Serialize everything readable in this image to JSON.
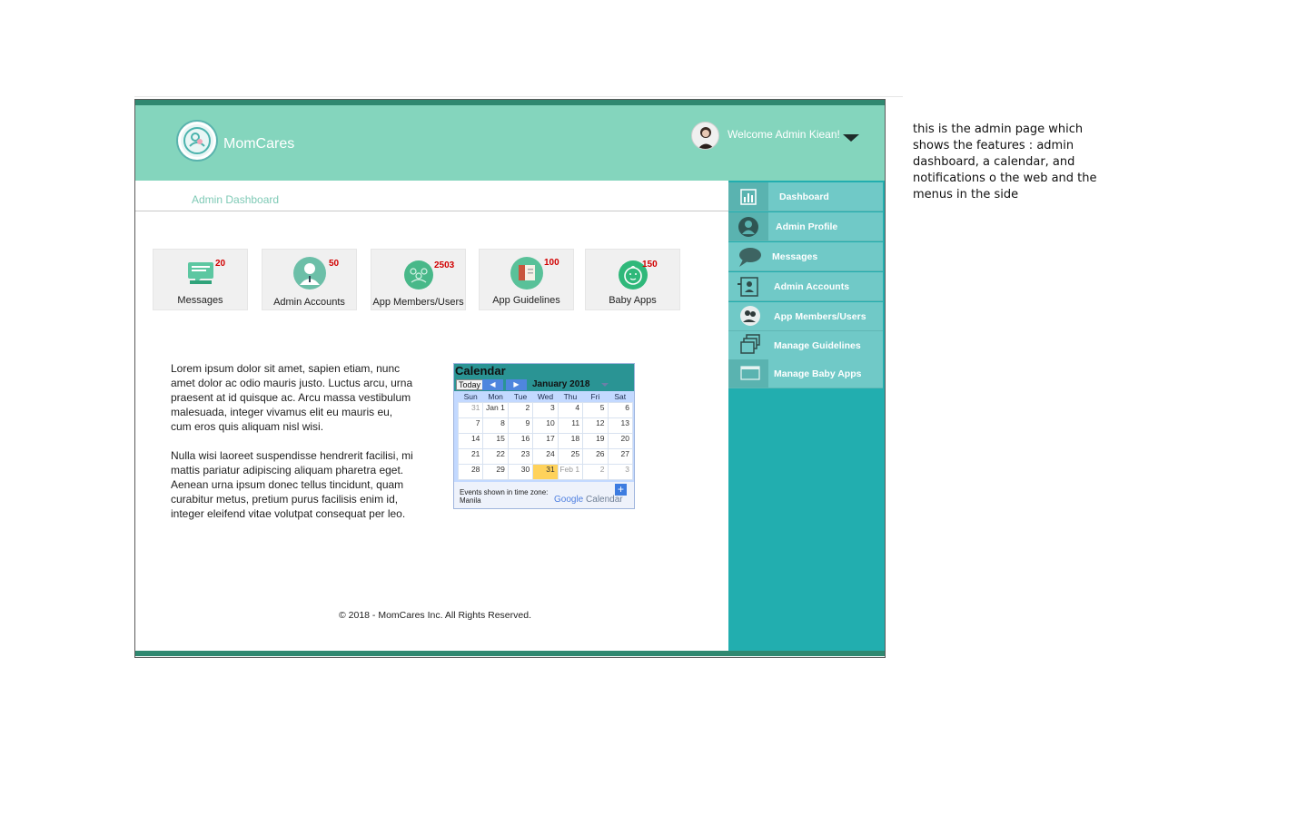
{
  "header": {
    "brand": "MomCares",
    "welcome": "Welcome Admin Kiean!"
  },
  "breadcrumb": "Admin Dashboard",
  "stats": [
    {
      "label": "Messages",
      "count": "20"
    },
    {
      "label": "Admin Accounts",
      "count": "50"
    },
    {
      "label": "App Members/Users",
      "count": "2503"
    },
    {
      "label": "App Guidelines",
      "count": "100"
    },
    {
      "label": "Baby Apps",
      "count": "150"
    }
  ],
  "content": {
    "paragraph1": "Lorem ipsum dolor sit amet, sapien etiam, nunc amet dolor ac odio mauris justo. Luctus arcu, urna praesent at id quisque ac. Arcu massa vestibulum malesuada, integer vivamus elit eu mauris eu, cum eros quis aliquam nisl wisi.",
    "paragraph2": "Nulla wisi laoreet suspendisse hendrerit facilisi, mi mattis pariatur adipiscing aliquam pharetra eget. Aenean urna ipsum donec tellus tincidunt, quam curabitur metus, pretium purus facilisis enim id, integer eleifend vitae volutpat consequat per leo."
  },
  "calendar": {
    "title": "Calendar",
    "today_label": "Today",
    "prev": "◀",
    "next": "▶",
    "month": "January 2018",
    "weekdays": [
      "Sun",
      "Mon",
      "Tue",
      "Wed",
      "Thu",
      "Fri",
      "Sat"
    ],
    "weeks": [
      [
        "31",
        "Jan 1",
        "2",
        "3",
        "4",
        "5",
        "6"
      ],
      [
        "7",
        "8",
        "9",
        "10",
        "11",
        "12",
        "13"
      ],
      [
        "14",
        "15",
        "16",
        "17",
        "18",
        "19",
        "20"
      ],
      [
        "21",
        "22",
        "23",
        "24",
        "25",
        "26",
        "27"
      ],
      [
        "28",
        "29",
        "30",
        "31",
        "Feb 1",
        "2",
        "3"
      ]
    ],
    "today": "31",
    "timezone_note": "Events shown in time zone: Manila",
    "add": "+",
    "brand_google": "Google",
    "brand_calendar": "Calendar"
  },
  "footer": "© 2018 - MomCares Inc. All Rights Reserved.",
  "sidebar": {
    "items": [
      {
        "label": "Dashboard",
        "icon": "chart-icon"
      },
      {
        "label": "Admin Profile",
        "icon": "user-icon"
      },
      {
        "label": "Messages",
        "icon": "chat-icon"
      },
      {
        "label": "Admin Accounts",
        "icon": "badge-icon"
      },
      {
        "label": "App Members/Users",
        "icon": "users-icon"
      },
      {
        "label": "Manage Guidelines",
        "icon": "stack-icon"
      },
      {
        "label": "Manage Baby Apps",
        "icon": "window-icon"
      }
    ]
  },
  "annotation": "this is the admin page which shows the features : admin dashboard, a calendar, and notifications o the web and the menus in the side"
}
